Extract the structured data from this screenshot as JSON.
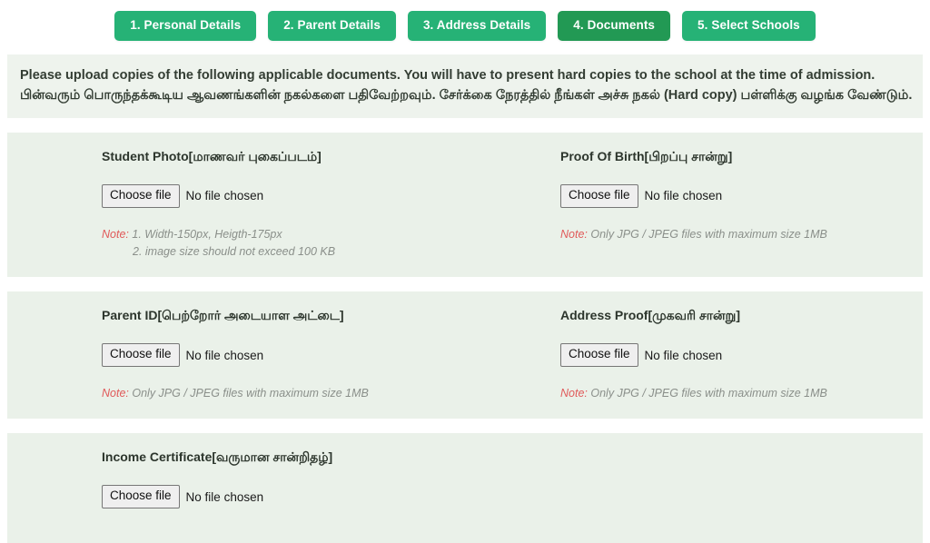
{
  "steps": [
    {
      "label": "1. Personal Details",
      "active": false
    },
    {
      "label": "2. Parent Details",
      "active": false
    },
    {
      "label": "3. Address Details",
      "active": false
    },
    {
      "label": "4. Documents",
      "active": true
    },
    {
      "label": "5. Select Schools",
      "active": false
    }
  ],
  "instruction": {
    "english": "Please upload copies of the following applicable documents. You will have to present hard copies to the school at the time of admission.",
    "tamil": "பின்வரும் பொருந்தக்கூடிய ஆவணங்களின் நகல்களை பதிவேற்றவும். சேர்க்கை நேரத்தில் நீங்கள் அச்சு நகல் (Hard copy) பள்ளிக்கு வழங்க வேண்டும்."
  },
  "file_input": {
    "button_label": "Choose file",
    "status_text": "No file chosen"
  },
  "documents": [
    {
      "label_en": "Student Photo",
      "label_ta": "[மாணவர் புகைப்படம்]",
      "note_keyword": "Note:",
      "note_line_1": " 1. Width-150px, Heigth-175px",
      "note_line_2": "2. image size should not exceed 100 KB"
    },
    {
      "label_en": "Proof Of Birth",
      "label_ta": "[பிறப்பு சான்று]",
      "note_keyword": "Note:",
      "note_line_1": " Only JPG / JPEG files with maximum size 1MB",
      "note_line_2": ""
    },
    {
      "label_en": "Parent ID",
      "label_ta": "[பெற்றோர் அடையாள அட்டை]",
      "note_keyword": "Note:",
      "note_line_1": " Only JPG / JPEG files with maximum size 1MB",
      "note_line_2": ""
    },
    {
      "label_en": "Address Proof",
      "label_ta": "[முகவரி சான்று]",
      "note_keyword": "Note:",
      "note_line_1": " Only JPG / JPEG files with maximum size 1MB",
      "note_line_2": ""
    },
    {
      "label_en": "Income Certificate",
      "label_ta": "[வருமான சான்றிதழ்]",
      "note_keyword": "",
      "note_line_1": "",
      "note_line_2": ""
    }
  ],
  "colors": {
    "tab_inactive": "#26b276",
    "tab_active": "#229954",
    "banner_bg": "#eef3ed",
    "card_bg": "#eaf1e9",
    "note_keyword": "#e05a5a",
    "note_text": "#8a8f8a"
  }
}
